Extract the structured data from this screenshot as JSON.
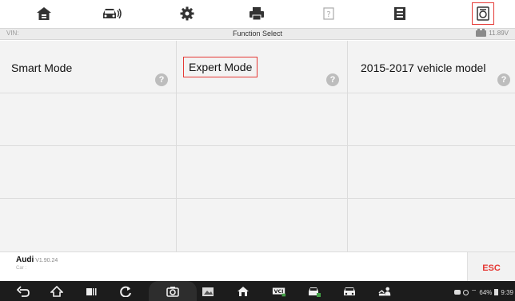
{
  "toolbar": {
    "icons": [
      "home-icon",
      "car-diagnostics-icon",
      "settings-gear-icon",
      "print-icon",
      "help-icon",
      "save-icon",
      "selected-data-icon"
    ]
  },
  "header": {
    "vin_label": "VIN:",
    "title": "Function Select",
    "battery_voltage": "11.89V"
  },
  "grid": {
    "items": [
      {
        "label": "Smart Mode",
        "has_help": true
      },
      {
        "label": "Expert Mode",
        "has_help": true,
        "highlighted": true
      },
      {
        "label": "2015-2017 vehicle model",
        "has_help": true
      }
    ],
    "help_glyph": "?"
  },
  "footer": {
    "brand": "Audi",
    "version": "V1.90.24",
    "car_label": "Car :",
    "esc_label": "ESC"
  },
  "statusbar": {
    "battery": "64%",
    "time": "9:39"
  },
  "colors": {
    "accent_red": "#e53935",
    "grid_bg": "#f3f3f3",
    "nav_bg": "#1c1c1c"
  }
}
